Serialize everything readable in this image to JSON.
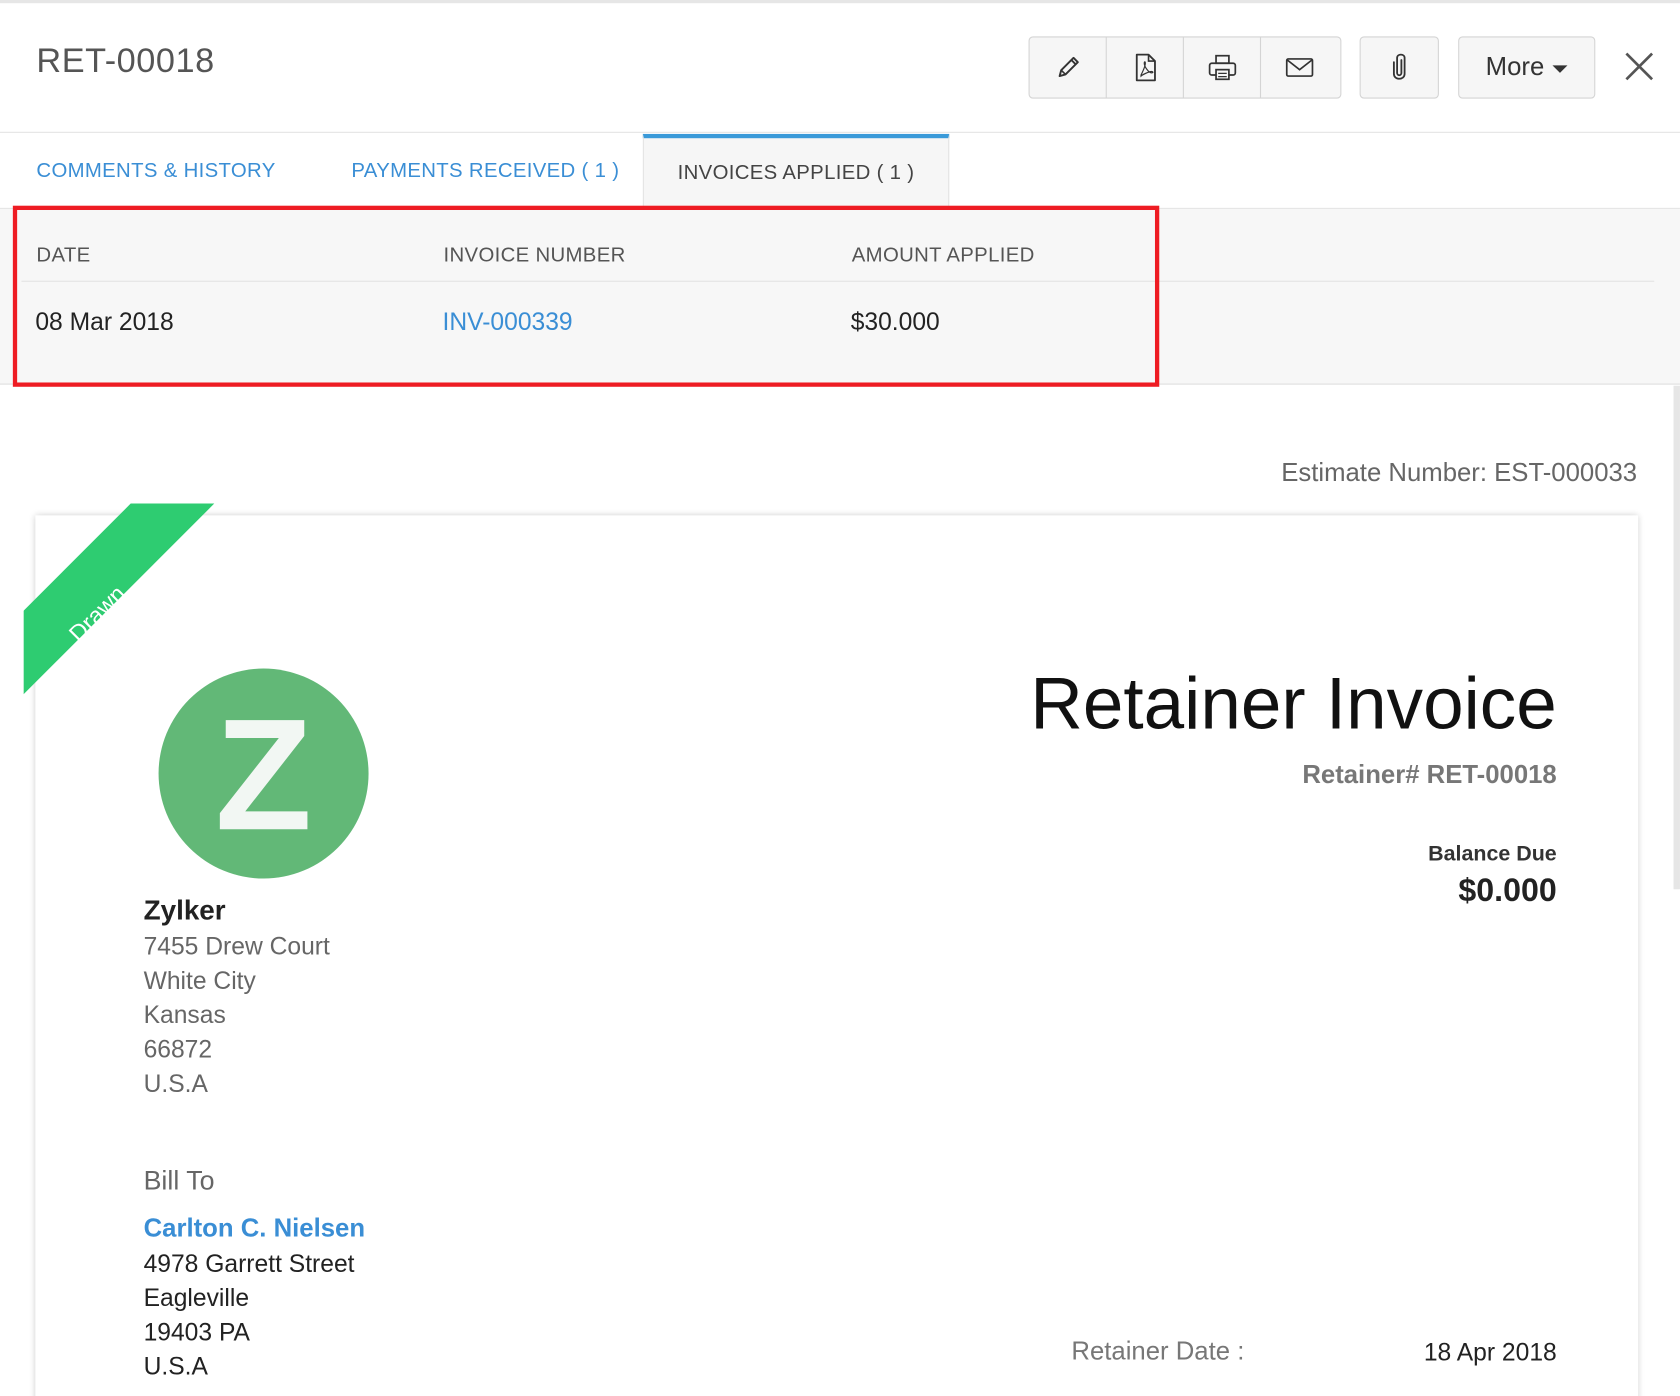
{
  "header": {
    "title": "RET-00018",
    "more_label": "More",
    "toolbar_icons": [
      "edit-icon",
      "pdf-icon",
      "print-icon",
      "mail-icon"
    ],
    "attach_icon": "paperclip-icon",
    "close_icon": "close-icon"
  },
  "tabs": [
    {
      "label": "COMMENTS & HISTORY",
      "active": false
    },
    {
      "label": "PAYMENTS RECEIVED ( 1 )",
      "active": false
    },
    {
      "label": "INVOICES APPLIED ( 1 )",
      "active": true
    }
  ],
  "applied": {
    "columns": [
      "DATE",
      "INVOICE NUMBER",
      "AMOUNT APPLIED"
    ],
    "rows": [
      {
        "date": "08 Mar 2018",
        "invoice_number": "INV-000339",
        "amount": "$30.000"
      }
    ]
  },
  "estimate_number": "Estimate Number: EST-000033",
  "document": {
    "status_ribbon": "Drawn",
    "logo_letter": "Z",
    "org_name": "Zylker",
    "org_address": [
      "7455 Drew Court",
      "White City",
      "Kansas",
      "66872",
      "U.S.A"
    ],
    "bill_to_label": "Bill To",
    "client_name": "Carlton C. Nielsen",
    "client_address": [
      "4978 Garrett Street",
      "Eagleville",
      "19403 PA",
      "U.S.A"
    ],
    "title": "Retainer Invoice",
    "retainer_number": "Retainer# RET-00018",
    "balance_due_label": "Balance Due",
    "balance_due_value": "$0.000",
    "retainer_date_label": "Retainer Date :",
    "retainer_date_value": "18 Apr 2018"
  },
  "colors": {
    "accent": "#3a8ed5",
    "highlight": "#ee1c23",
    "ribbon": "#2ecc71",
    "logo": "#62b877"
  }
}
